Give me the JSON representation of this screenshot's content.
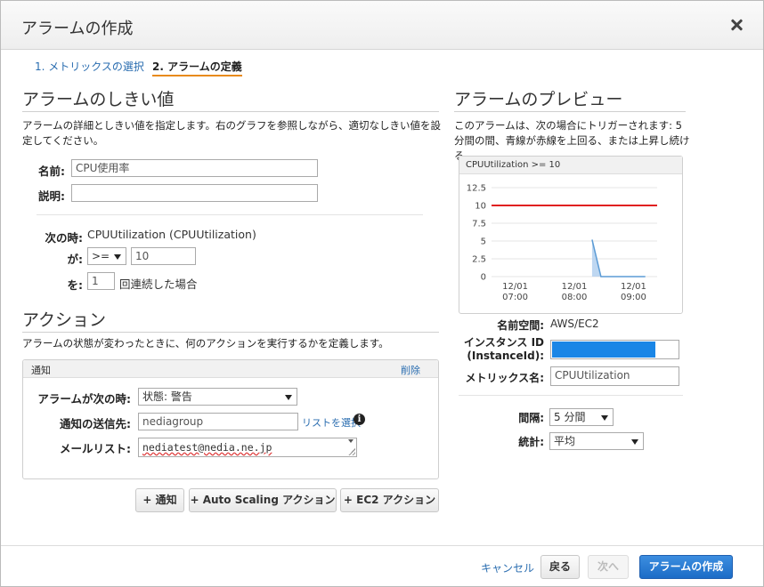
{
  "dialog": {
    "title": "アラームの作成"
  },
  "steps": [
    {
      "label": "1. メトリックスの選択"
    },
    {
      "label": "2. アラームの定義"
    }
  ],
  "threshold": {
    "heading": "アラームのしきい値",
    "description": "アラームの詳細としきい値を指定します。右のグラフを参照しながら、適切なしきい値を設定してください。",
    "name_label": "名前:",
    "name_value": "CPU使用率",
    "desc_label": "説明:",
    "desc_value": "",
    "when_label": "次の時:",
    "when_value": "CPUUtilization (CPUUtilization)",
    "is_label": "が:",
    "operator": ">=",
    "threshold_value": "10",
    "for_label": "を:",
    "periods": "1",
    "periods_suffix": "回連続した場合"
  },
  "actions": {
    "heading": "アクション",
    "description": "アラームの状態が変わったときに、何のアクションを実行するかを定義します。",
    "notify_title": "通知",
    "delete_label": "削除",
    "state_label": "アラームが次の時:",
    "state_value": "状態: 警告",
    "send_to_label": "通知の送信先:",
    "send_to_value": "nediagroup",
    "select_list_label": "リストを選択",
    "info_icon": "i",
    "email_label": "メールリスト:",
    "email_value": "nediatest@nedia.ne.jp",
    "add_notification": "+ 通知",
    "add_autoscaling": "+ Auto Scaling アクション",
    "add_ec2": "+ EC2 アクション"
  },
  "preview": {
    "heading": "アラームのプレビュー",
    "description": "このアラームは、次の場合にトリガーされます: 5 分間の間、青線が赤線を上回る、または上昇し続ける",
    "chart_title": "CPUUtilization >= 10",
    "namespace_label": "名前空間:",
    "namespace_value": "AWS/EC2",
    "instance_label_1": "インスタンス ID",
    "instance_label_2": "(InstanceId):",
    "metric_label": "メトリックス名:",
    "metric_value": "CPUUtilization",
    "period_label": "間隔:",
    "period_value": "5 分間",
    "stat_label": "統計:",
    "stat_value": "平均"
  },
  "chart_data": {
    "type": "line",
    "title": "CPUUtilization >= 10",
    "ylim": [
      0,
      12.5
    ],
    "yticks": [
      "12.5",
      "10",
      "7.5",
      "5",
      "2.5",
      "0"
    ],
    "xticks": [
      {
        "date": "12/01",
        "time": "07:00"
      },
      {
        "date": "12/01",
        "time": "08:00"
      },
      {
        "date": "12/01",
        "time": "09:00"
      }
    ],
    "threshold": 10,
    "threshold_color": "#e02020",
    "series_color": "#5b9bd5",
    "series": [
      {
        "values": [
          [
            8.3,
            5.2
          ],
          [
            8.45,
            0
          ],
          [
            9.2,
            0
          ]
        ]
      }
    ],
    "x_range": [
      6.6,
      9.4
    ]
  },
  "footer": {
    "cancel": "キャンセル",
    "back": "戻る",
    "next": "次へ",
    "create": "アラームの作成"
  }
}
